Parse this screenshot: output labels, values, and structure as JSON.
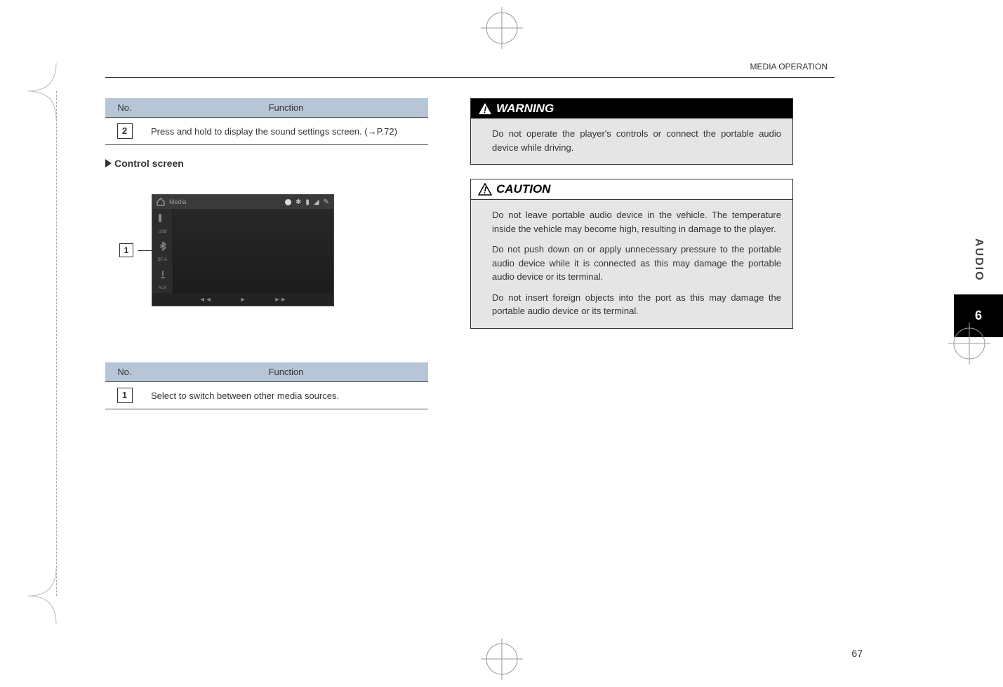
{
  "header": {
    "section": "MEDIA OPERATION"
  },
  "side": {
    "label": "AUDIO",
    "chapter": "6"
  },
  "left": {
    "table1": {
      "headers": {
        "no": "No.",
        "func": "Function"
      },
      "row": {
        "num": "2",
        "text": "Press and hold to display the sound settings screen. (→P.72)"
      }
    },
    "subheading": "Control screen",
    "screenshot": {
      "callout_num": "1",
      "media_label": "Media",
      "leftstrip": {
        "usb": "USB",
        "bta": "BT-A",
        "aux": "AUX"
      },
      "playbar": {
        "prev": "◄◄",
        "play": "►",
        "next": "►►"
      }
    },
    "table2": {
      "headers": {
        "no": "No.",
        "func": "Function"
      },
      "row": {
        "num": "1",
        "text": "Select to switch between other media sources."
      }
    }
  },
  "right": {
    "warning": {
      "title": "WARNING",
      "items": [
        "Do not operate the player's controls or connect the portable audio device while driving."
      ]
    },
    "caution": {
      "title": "CAUTION",
      "items": [
        "Do not leave portable audio device in the vehicle. The temperature inside the vehicle may become high, resulting in damage to the player.",
        "Do not push down on or apply unnecessary pressure to the portable audio device while it is connected as this may damage the portable audio device or its terminal.",
        "Do not insert foreign objects into the port as this may damage the portable audio device or its terminal."
      ]
    }
  },
  "page_number": "67"
}
